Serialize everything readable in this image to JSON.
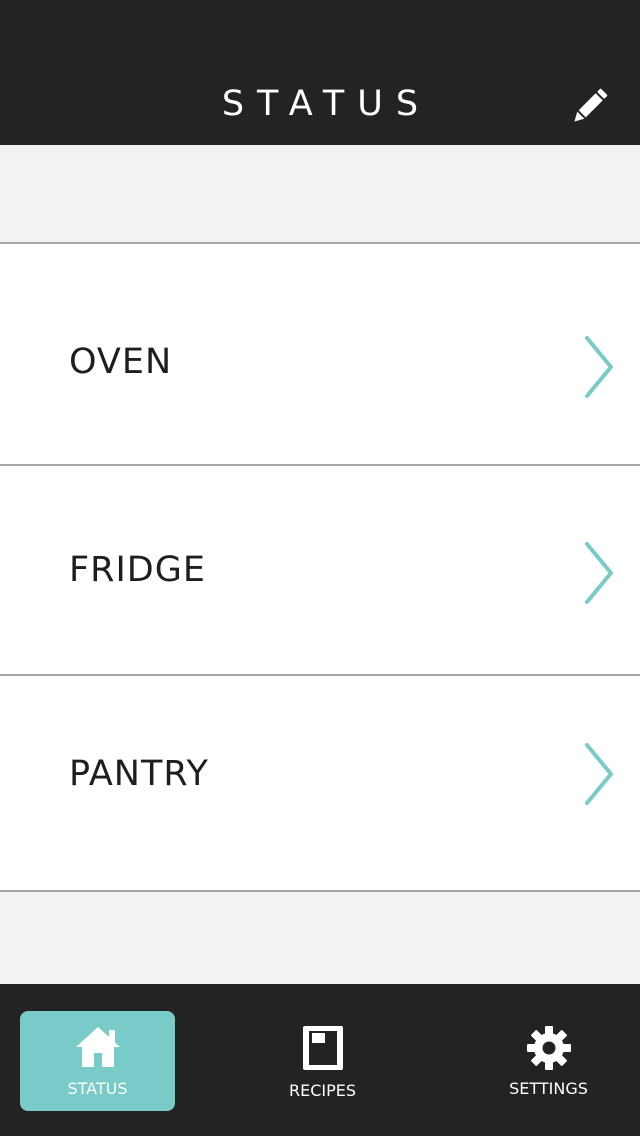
{
  "header": {
    "title": "STATUS",
    "edit_icon": "pencil-icon"
  },
  "list": {
    "items": [
      {
        "label": "OVEN",
        "icon": "chevron-right-icon"
      },
      {
        "label": "FRIDGE",
        "icon": "chevron-right-icon"
      },
      {
        "label": "PANTRY",
        "icon": "chevron-right-icon"
      }
    ]
  },
  "tabbar": {
    "tabs": [
      {
        "label": "STATUS",
        "icon": "home-icon",
        "active": true
      },
      {
        "label": "RECIPES",
        "icon": "book-icon",
        "active": false
      },
      {
        "label": "SETTINGS",
        "icon": "gear-icon",
        "active": false
      }
    ]
  },
  "colors": {
    "header_bg": "#232323",
    "accent": "#78cbc8",
    "page_bg": "#f2f2f2",
    "row_bg": "#ffffff",
    "divider": "#a6a6a6"
  }
}
